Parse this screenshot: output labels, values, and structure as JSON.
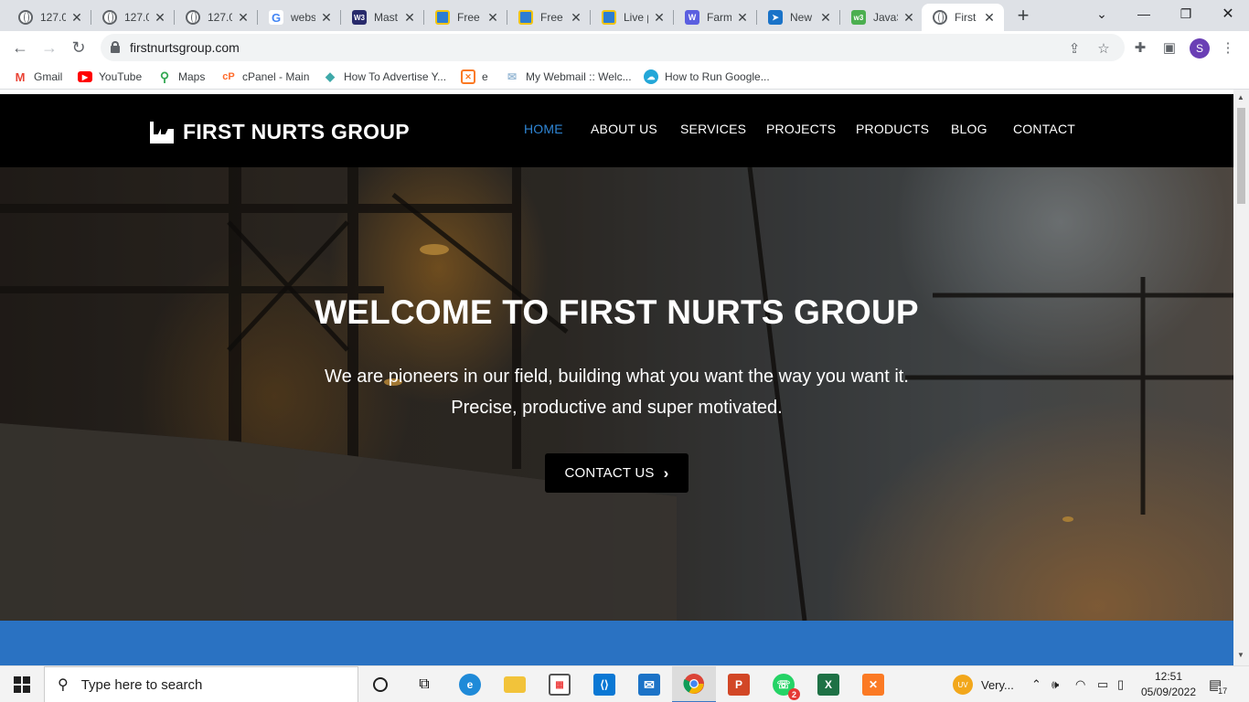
{
  "browser": {
    "tabs": [
      {
        "title": "127.0",
        "icon": "globe-icon"
      },
      {
        "title": "127.0",
        "icon": "globe-icon"
      },
      {
        "title": "127.0",
        "icon": "globe-icon"
      },
      {
        "title": "webs",
        "icon": "google-icon"
      },
      {
        "title": "Mast",
        "icon": "w3-icon"
      },
      {
        "title": "Free",
        "icon": "template-icon"
      },
      {
        "title": "Free",
        "icon": "template-icon"
      },
      {
        "title": "Live p",
        "icon": "template-icon"
      },
      {
        "title": "Farm",
        "icon": "w-icon"
      },
      {
        "title": "New",
        "icon": "arrow-icon"
      },
      {
        "title": "JavaS",
        "icon": "w3schools-icon"
      },
      {
        "title": "First",
        "icon": "globe-icon"
      }
    ],
    "url": "firstnurtsgroup.com",
    "profile_initial": "S",
    "bookmarks": [
      {
        "label": "Gmail",
        "icon": "gmail-icon"
      },
      {
        "label": "YouTube",
        "icon": "youtube-icon"
      },
      {
        "label": "Maps",
        "icon": "maps-icon"
      },
      {
        "label": "cPanel - Main",
        "icon": "cpanel-icon"
      },
      {
        "label": "How To Advertise Y...",
        "icon": "diamond-icon"
      },
      {
        "label": "e",
        "icon": "xampp-icon"
      },
      {
        "label": "My Webmail :: Welc...",
        "icon": "webmail-icon"
      },
      {
        "label": "How to Run Google...",
        "icon": "cloud-icon"
      }
    ]
  },
  "site": {
    "logo": "FIRST NURTS GROUP",
    "menu": [
      "HOME",
      "ABOUT US",
      "SERVICES",
      "PROJECTS",
      "PRODUCTS",
      "BLOG",
      "CONTACT"
    ],
    "active_menu": "HOME",
    "hero": {
      "title": "WELCOME TO FIRST NURTS GROUP",
      "subtitle_line1": "We are pioneers in our field, building what you want the way you want it.",
      "subtitle_line2": "Precise, productive and super motivated.",
      "cta": "CONTACT US"
    },
    "colors": {
      "accent": "#2f86d6",
      "band": "#2a72c2",
      "nav_bg": "#000000"
    }
  },
  "taskbar": {
    "search_placeholder": "Type here to search",
    "weather": "Very...",
    "time": "12:51",
    "date": "05/09/2022",
    "notifications": "17",
    "whatsapp_badge": "2"
  }
}
